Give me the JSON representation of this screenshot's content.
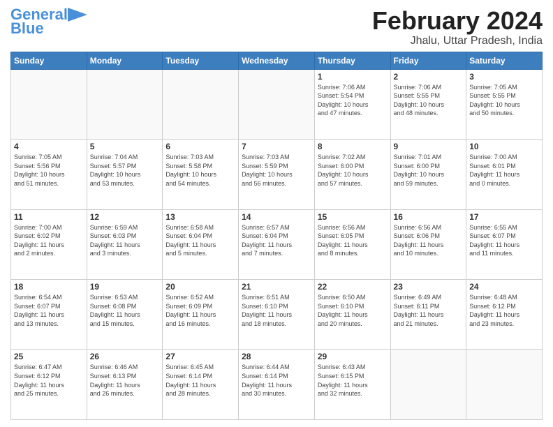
{
  "logo": {
    "line1": "General",
    "line2": "Blue"
  },
  "header": {
    "month": "February 2024",
    "location": "Jhalu, Uttar Pradesh, India"
  },
  "days_of_week": [
    "Sunday",
    "Monday",
    "Tuesday",
    "Wednesday",
    "Thursday",
    "Friday",
    "Saturday"
  ],
  "weeks": [
    [
      {
        "day": "",
        "info": ""
      },
      {
        "day": "",
        "info": ""
      },
      {
        "day": "",
        "info": ""
      },
      {
        "day": "",
        "info": ""
      },
      {
        "day": "1",
        "info": "Sunrise: 7:06 AM\nSunset: 5:54 PM\nDaylight: 10 hours\nand 47 minutes."
      },
      {
        "day": "2",
        "info": "Sunrise: 7:06 AM\nSunset: 5:55 PM\nDaylight: 10 hours\nand 48 minutes."
      },
      {
        "day": "3",
        "info": "Sunrise: 7:05 AM\nSunset: 5:55 PM\nDaylight: 10 hours\nand 50 minutes."
      }
    ],
    [
      {
        "day": "4",
        "info": "Sunrise: 7:05 AM\nSunset: 5:56 PM\nDaylight: 10 hours\nand 51 minutes."
      },
      {
        "day": "5",
        "info": "Sunrise: 7:04 AM\nSunset: 5:57 PM\nDaylight: 10 hours\nand 53 minutes."
      },
      {
        "day": "6",
        "info": "Sunrise: 7:03 AM\nSunset: 5:58 PM\nDaylight: 10 hours\nand 54 minutes."
      },
      {
        "day": "7",
        "info": "Sunrise: 7:03 AM\nSunset: 5:59 PM\nDaylight: 10 hours\nand 56 minutes."
      },
      {
        "day": "8",
        "info": "Sunrise: 7:02 AM\nSunset: 6:00 PM\nDaylight: 10 hours\nand 57 minutes."
      },
      {
        "day": "9",
        "info": "Sunrise: 7:01 AM\nSunset: 6:00 PM\nDaylight: 10 hours\nand 59 minutes."
      },
      {
        "day": "10",
        "info": "Sunrise: 7:00 AM\nSunset: 6:01 PM\nDaylight: 11 hours\nand 0 minutes."
      }
    ],
    [
      {
        "day": "11",
        "info": "Sunrise: 7:00 AM\nSunset: 6:02 PM\nDaylight: 11 hours\nand 2 minutes."
      },
      {
        "day": "12",
        "info": "Sunrise: 6:59 AM\nSunset: 6:03 PM\nDaylight: 11 hours\nand 3 minutes."
      },
      {
        "day": "13",
        "info": "Sunrise: 6:58 AM\nSunset: 6:04 PM\nDaylight: 11 hours\nand 5 minutes."
      },
      {
        "day": "14",
        "info": "Sunrise: 6:57 AM\nSunset: 6:04 PM\nDaylight: 11 hours\nand 7 minutes."
      },
      {
        "day": "15",
        "info": "Sunrise: 6:56 AM\nSunset: 6:05 PM\nDaylight: 11 hours\nand 8 minutes."
      },
      {
        "day": "16",
        "info": "Sunrise: 6:56 AM\nSunset: 6:06 PM\nDaylight: 11 hours\nand 10 minutes."
      },
      {
        "day": "17",
        "info": "Sunrise: 6:55 AM\nSunset: 6:07 PM\nDaylight: 11 hours\nand 11 minutes."
      }
    ],
    [
      {
        "day": "18",
        "info": "Sunrise: 6:54 AM\nSunset: 6:07 PM\nDaylight: 11 hours\nand 13 minutes."
      },
      {
        "day": "19",
        "info": "Sunrise: 6:53 AM\nSunset: 6:08 PM\nDaylight: 11 hours\nand 15 minutes."
      },
      {
        "day": "20",
        "info": "Sunrise: 6:52 AM\nSunset: 6:09 PM\nDaylight: 11 hours\nand 16 minutes."
      },
      {
        "day": "21",
        "info": "Sunrise: 6:51 AM\nSunset: 6:10 PM\nDaylight: 11 hours\nand 18 minutes."
      },
      {
        "day": "22",
        "info": "Sunrise: 6:50 AM\nSunset: 6:10 PM\nDaylight: 11 hours\nand 20 minutes."
      },
      {
        "day": "23",
        "info": "Sunrise: 6:49 AM\nSunset: 6:11 PM\nDaylight: 11 hours\nand 21 minutes."
      },
      {
        "day": "24",
        "info": "Sunrise: 6:48 AM\nSunset: 6:12 PM\nDaylight: 11 hours\nand 23 minutes."
      }
    ],
    [
      {
        "day": "25",
        "info": "Sunrise: 6:47 AM\nSunset: 6:12 PM\nDaylight: 11 hours\nand 25 minutes."
      },
      {
        "day": "26",
        "info": "Sunrise: 6:46 AM\nSunset: 6:13 PM\nDaylight: 11 hours\nand 26 minutes."
      },
      {
        "day": "27",
        "info": "Sunrise: 6:45 AM\nSunset: 6:14 PM\nDaylight: 11 hours\nand 28 minutes."
      },
      {
        "day": "28",
        "info": "Sunrise: 6:44 AM\nSunset: 6:14 PM\nDaylight: 11 hours\nand 30 minutes."
      },
      {
        "day": "29",
        "info": "Sunrise: 6:43 AM\nSunset: 6:15 PM\nDaylight: 11 hours\nand 32 minutes."
      },
      {
        "day": "",
        "info": ""
      },
      {
        "day": "",
        "info": ""
      }
    ]
  ]
}
